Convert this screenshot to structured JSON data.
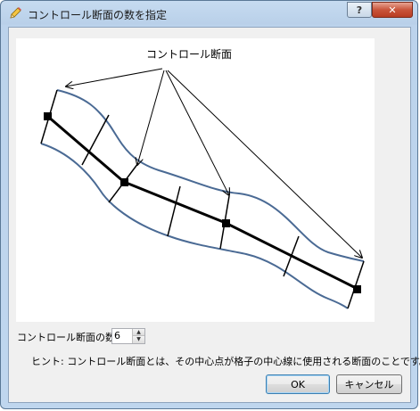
{
  "window": {
    "title": "コントロール断面の数を指定",
    "help_button": "?",
    "close_button": "✕"
  },
  "diagram": {
    "callout_label": "コントロール断面"
  },
  "form": {
    "count_label": "コントロール断面の数:",
    "count_value": "6"
  },
  "hint": "ヒント: コントロール断面とは、その中心点が格子の中心線に使用される断面のことです。",
  "buttons": {
    "ok": "OK",
    "cancel": "キャンセル"
  },
  "colors": {
    "band_outline": "#4a6a94",
    "centerline": "#000000"
  }
}
